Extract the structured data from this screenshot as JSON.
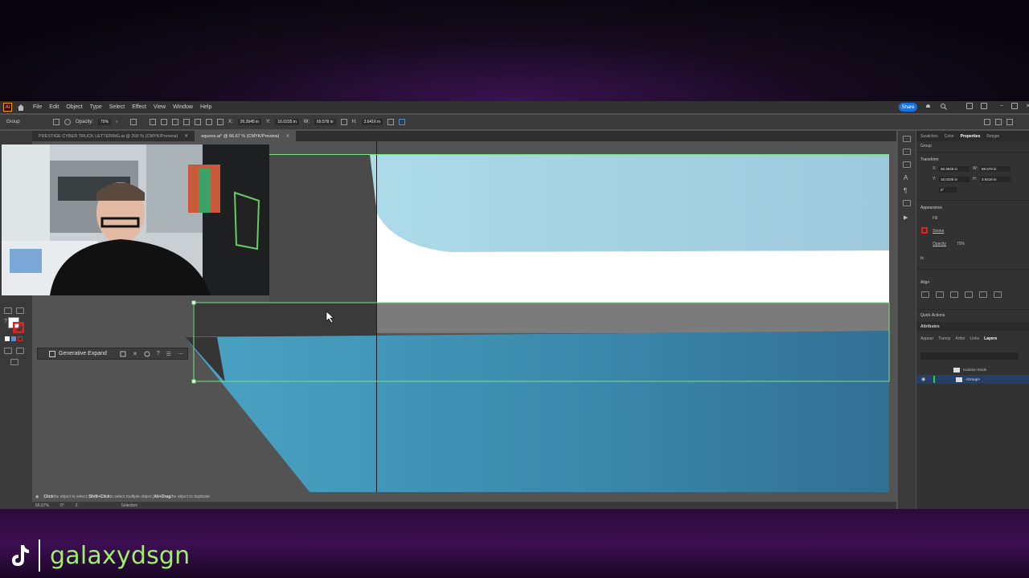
{
  "app": {
    "logo_text": "Ai",
    "menu": [
      "File",
      "Edit",
      "Object",
      "Type",
      "Select",
      "Effect",
      "View",
      "Window",
      "Help"
    ],
    "share_label": "Share"
  },
  "controlbar": {
    "selection_type": "Group",
    "opacity_label": "Opacity:",
    "opacity_value": "70%",
    "x_label": "X:",
    "x_value": "26.3945 in",
    "y_label": "Y:",
    "y_value": "16.0235 in",
    "w_label": "W:",
    "w_value": "69.578 in",
    "h_label": "H:",
    "h_value": "3.6416 in"
  },
  "tabs": [
    {
      "label": "PRESTIGE CYBER TRUCK LETTERING.ai @ 200 % (CMYK/Preview)",
      "active": false
    },
    {
      "label": "equnox.ai* @ 66.67 % (CMYK/Preview)",
      "active": true
    }
  ],
  "canvas": {
    "selection_stroke": "#7fe08a",
    "light_blue": "#a7d3e3",
    "mid_blue": "#3f94b4",
    "deep_blue": "#2f6f93"
  },
  "generative_expand": {
    "label": "Generative Expand"
  },
  "status": {
    "hint_1_bold": "Click",
    "hint_1": " the object to select | ",
    "hint_2_bold": "Shift+Click",
    "hint_2": " to select multiple object | ",
    "hint_3_bold": "Alt+Drag",
    "hint_3": " the object to duplicate",
    "zoom": "66.67%",
    "rotate": "0°",
    "artboard": "2",
    "tool": "Selection"
  },
  "right_panel": {
    "tabs": [
      "Swatches",
      "Color",
      "Properties",
      "Retype"
    ],
    "active_tab": "Properties",
    "group_label": "Group",
    "transform_title": "Transform",
    "x_label": "X:",
    "x_value": "26.3945 in",
    "y_label": "Y:",
    "y_value": "16.0235 in",
    "w_label": "W:",
    "w_value": "69.578 in",
    "h_label": "H:",
    "h_value": "3.6416 in",
    "rotate_value": "0°",
    "appearance_title": "Appearance",
    "fill_label": "Fill",
    "stroke_label": "Stroke",
    "opacity_label": "Opacity",
    "opacity_value": "70%",
    "fx_label": "fx.",
    "align_title": "Align",
    "quick_actions_title": "Quick Actions",
    "attributes_label": "Attributes",
    "layer_tabs": [
      "Appear",
      "Transp",
      "Artbo",
      "Links",
      "Layers"
    ],
    "active_layer_tab": "Layers",
    "layers": [
      {
        "name": "Isolation Mode"
      },
      {
        "name": "<Group>"
      }
    ]
  },
  "watermark": {
    "handle": "galaxydsgn"
  }
}
